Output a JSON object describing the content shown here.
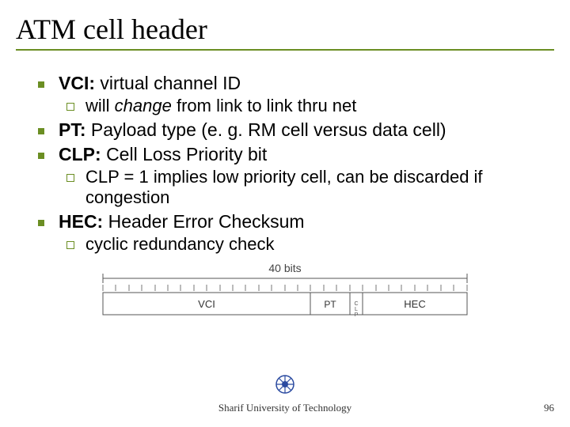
{
  "title": "ATM cell header",
  "bullets": [
    {
      "label": "VCI:",
      "text": "virtual channel ID",
      "sub": [
        {
          "emph": "change",
          "pre": "will ",
          "post": " from link to link thru net"
        }
      ]
    },
    {
      "label": "PT:",
      "text": "Payload type (e. g. RM cell versus data cell)",
      "sub": []
    },
    {
      "label": "CLP:",
      "text": "Cell Loss Priority bit",
      "sub": [
        {
          "pre": "CLP = 1 implies low priority cell, can be discarded if congestion",
          "emph": "",
          "post": ""
        }
      ]
    },
    {
      "label": "HEC:",
      "text": "Header Error Checksum",
      "sub": [
        {
          "pre": "cyclic redundancy check",
          "emph": "",
          "post": ""
        }
      ]
    }
  ],
  "diagram": {
    "total_label": "40 bits",
    "fields": [
      {
        "name": "VCI",
        "bits": 16
      },
      {
        "name": "PT",
        "bits": 3
      },
      {
        "name": "CLP",
        "bits": 1
      },
      {
        "name": "HEC",
        "bits": 8
      }
    ]
  },
  "footer": "Sharif University of Technology",
  "page": "96"
}
